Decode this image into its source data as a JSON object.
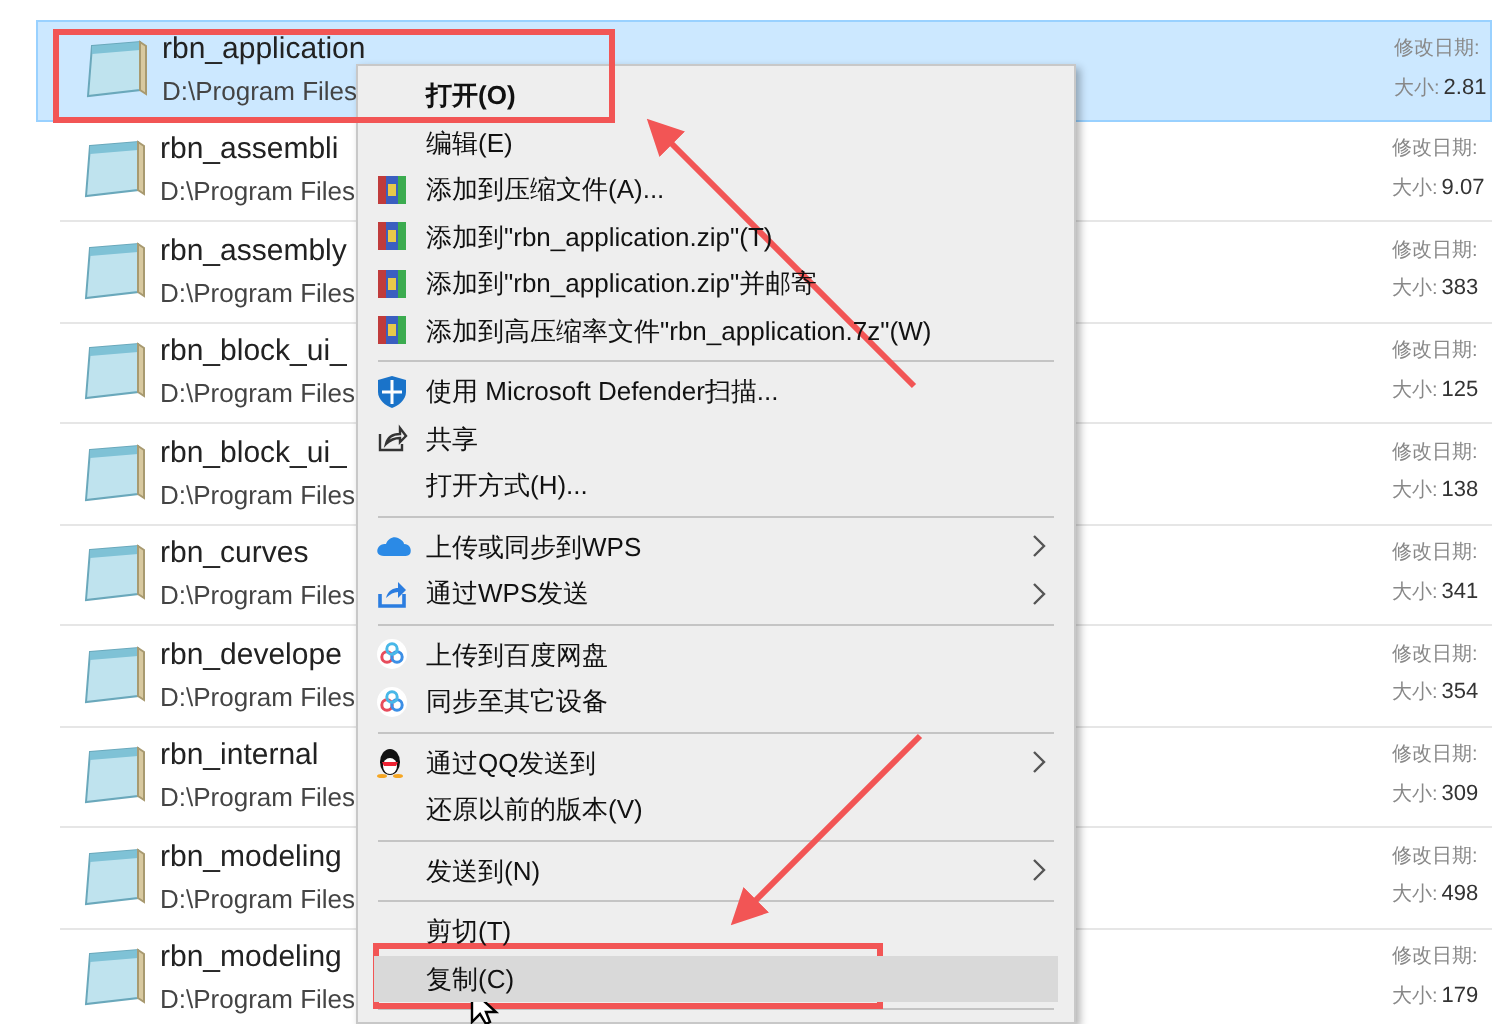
{
  "files": [
    {
      "name": "rbn_application",
      "path": "D:\\Program Files",
      "modified": "修改日期:",
      "size_label": "大小:",
      "size": "2.81",
      "selected": true
    },
    {
      "name": "rbn_assembli",
      "path": "D:\\Program Files",
      "modified": "修改日期:",
      "size_label": "大小:",
      "size": "9.07",
      "selected": false
    },
    {
      "name": "rbn_assembly",
      "path": "D:\\Program Files",
      "modified": "修改日期:",
      "size_label": "大小:",
      "size": "383",
      "selected": false
    },
    {
      "name": "rbn_block_ui_",
      "path": "D:\\Program Files",
      "modified": "修改日期:",
      "size_label": "大小:",
      "size": "125",
      "selected": false
    },
    {
      "name": "rbn_block_ui_",
      "path": "D:\\Program Files",
      "modified": "修改日期:",
      "size_label": "大小:",
      "size": "138",
      "selected": false
    },
    {
      "name": "rbn_curves",
      "path": "D:\\Program Files",
      "modified": "修改日期:",
      "size_label": "大小:",
      "size": "341",
      "selected": false
    },
    {
      "name": "rbn_develope",
      "path": "D:\\Program Files",
      "modified": "修改日期:",
      "size_label": "大小:",
      "size": "354",
      "selected": false
    },
    {
      "name": "rbn_internal",
      "path": "D:\\Program Files",
      "modified": "修改日期:",
      "size_label": "大小:",
      "size": "309",
      "selected": false
    },
    {
      "name": "rbn_modeling",
      "path": "D:\\Program Files",
      "modified": "修改日期:",
      "size_label": "大小:",
      "size": "498",
      "selected": false
    },
    {
      "name": "rbn_modeling",
      "path": "D:\\Program Files",
      "modified": "修改日期:",
      "size_label": "大小:",
      "size": "179",
      "selected": false
    }
  ],
  "context_menu": {
    "items": [
      {
        "kind": "plain",
        "label": "打开(O)",
        "default": true,
        "submenu": false,
        "selected": false
      },
      {
        "kind": "plain",
        "label": "编辑(E)",
        "default": false,
        "submenu": false,
        "selected": false
      },
      {
        "kind": "archive",
        "label": "添加到压缩文件(A)...",
        "default": false,
        "submenu": false,
        "selected": false
      },
      {
        "kind": "archive",
        "label": "添加到\"rbn_application.zip\"(T)",
        "default": false,
        "submenu": false,
        "selected": false
      },
      {
        "kind": "archive",
        "label": "添加到\"rbn_application.zip\"并邮寄",
        "default": false,
        "submenu": false,
        "selected": false
      },
      {
        "kind": "archive",
        "label": "添加到高压缩率文件\"rbn_application.7z\"(W)",
        "default": false,
        "submenu": false,
        "selected": false
      },
      {
        "kind": "separator"
      },
      {
        "kind": "shield",
        "label": "使用 Microsoft Defender扫描...",
        "default": false,
        "submenu": false,
        "selected": false
      },
      {
        "kind": "share",
        "label": "共享",
        "default": false,
        "submenu": false,
        "selected": false
      },
      {
        "kind": "plain",
        "label": "打开方式(H)...",
        "default": false,
        "submenu": false,
        "selected": false
      },
      {
        "kind": "separator"
      },
      {
        "kind": "cloud",
        "label": "上传或同步到WPS",
        "default": false,
        "submenu": true,
        "selected": false
      },
      {
        "kind": "send",
        "label": "通过WPS发送",
        "default": false,
        "submenu": true,
        "selected": false
      },
      {
        "kind": "separator"
      },
      {
        "kind": "baidu",
        "label": "上传到百度网盘",
        "default": false,
        "submenu": false,
        "selected": false
      },
      {
        "kind": "baidu",
        "label": "同步至其它设备",
        "default": false,
        "submenu": false,
        "selected": false
      },
      {
        "kind": "separator"
      },
      {
        "kind": "qq",
        "label": "通过QQ发送到",
        "default": false,
        "submenu": true,
        "selected": false
      },
      {
        "kind": "plain",
        "label": "还原以前的版本(V)",
        "default": false,
        "submenu": false,
        "selected": false
      },
      {
        "kind": "separator"
      },
      {
        "kind": "plain",
        "label": "发送到(N)",
        "default": false,
        "submenu": true,
        "selected": false
      },
      {
        "kind": "separator"
      },
      {
        "kind": "plain",
        "label": "剪切(T)",
        "default": false,
        "submenu": false,
        "selected": false
      },
      {
        "kind": "plain",
        "label": "复制(C)",
        "default": false,
        "submenu": false,
        "selected": true
      },
      {
        "kind": "separator"
      }
    ]
  }
}
